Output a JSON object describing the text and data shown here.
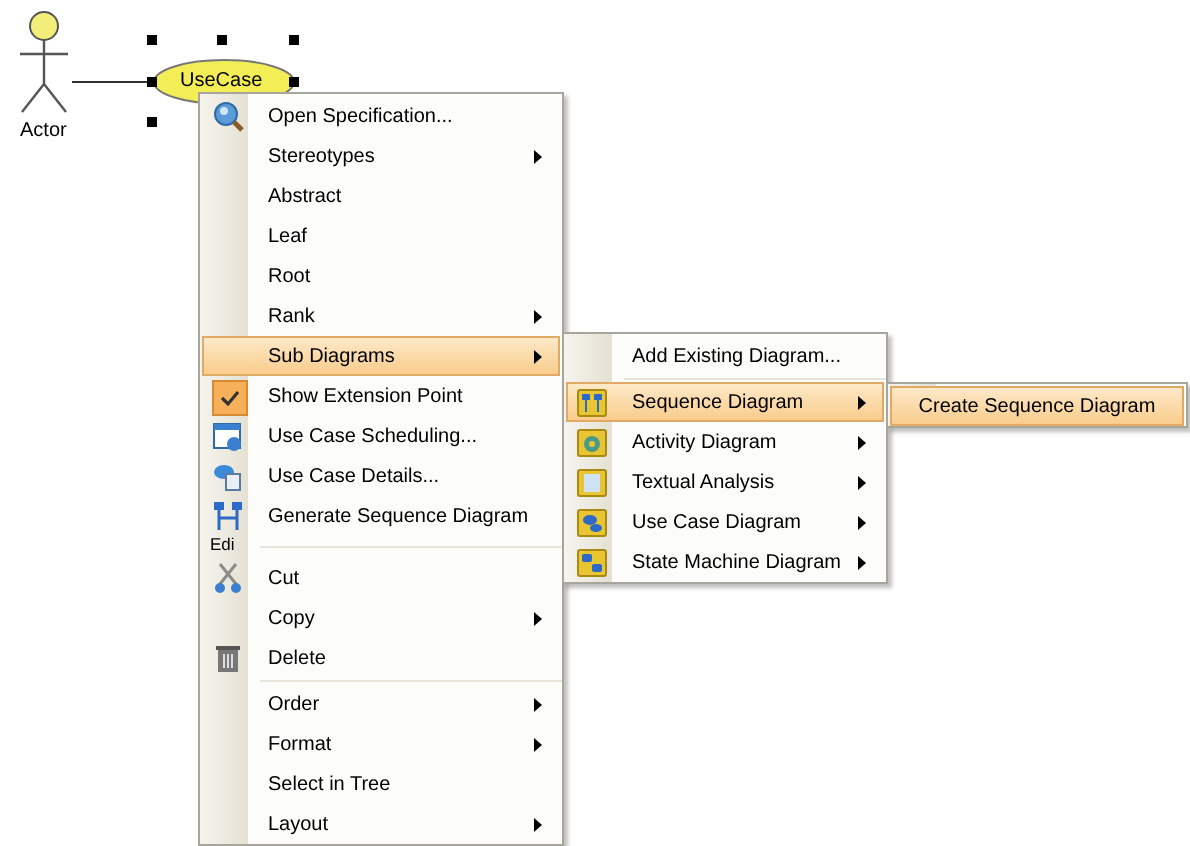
{
  "diagram": {
    "actor": {
      "label": "Actor"
    },
    "use_case": {
      "label": "UseCase",
      "selected": true
    }
  },
  "context_menu": {
    "groups": [
      {
        "items": [
          {
            "kind": "spec",
            "label": "Open Specification...",
            "submenu": false,
            "selected": false
          },
          {
            "kind": "plain",
            "label": "Stereotypes",
            "submenu": true,
            "selected": false
          },
          {
            "kind": "plain",
            "label": "Abstract",
            "submenu": false,
            "selected": false
          },
          {
            "kind": "plain",
            "label": "Leaf",
            "submenu": false,
            "selected": false
          },
          {
            "kind": "plain",
            "label": "Root",
            "submenu": false,
            "selected": false
          },
          {
            "kind": "plain",
            "label": "Rank",
            "submenu": true,
            "selected": false
          },
          {
            "kind": "plain",
            "label": "Sub Diagrams",
            "submenu": true,
            "selected": true
          },
          {
            "kind": "check",
            "label": "Show Extension Point",
            "submenu": false,
            "selected": false,
            "checked": true
          },
          {
            "kind": "schedule",
            "label": "Use Case Scheduling...",
            "submenu": false,
            "selected": false
          },
          {
            "kind": "details",
            "label": "Use Case Details...",
            "submenu": false,
            "selected": false
          },
          {
            "kind": "generate",
            "label": "Generate Sequence Diagram",
            "submenu": false,
            "selected": false
          }
        ]
      },
      {
        "fragment": "Edi",
        "items": [
          {
            "kind": "cut",
            "label": "Cut",
            "submenu": false,
            "selected": false
          },
          {
            "kind": "plain",
            "label": "Copy",
            "submenu": true,
            "selected": false
          },
          {
            "kind": "delete",
            "label": "Delete",
            "submenu": false,
            "selected": false
          }
        ]
      },
      {
        "items": [
          {
            "kind": "plain",
            "label": "Order",
            "submenu": true,
            "selected": false
          },
          {
            "kind": "plain",
            "label": "Format",
            "submenu": true,
            "selected": false
          },
          {
            "kind": "plain",
            "label": "Select in Tree",
            "submenu": false,
            "selected": false
          },
          {
            "kind": "plain",
            "label": "Layout",
            "submenu": true,
            "selected": false
          }
        ]
      }
    ]
  },
  "sub_menu": {
    "groups": [
      {
        "items": [
          {
            "kind": "plain",
            "label": "Add Existing Diagram...",
            "submenu": false,
            "selected": false
          }
        ]
      },
      {
        "items": [
          {
            "kind": "sequence",
            "label": "Sequence Diagram",
            "submenu": true,
            "selected": true
          },
          {
            "kind": "activity",
            "label": "Activity Diagram",
            "submenu": true,
            "selected": false
          },
          {
            "kind": "textual",
            "label": "Textual Analysis",
            "submenu": true,
            "selected": false
          },
          {
            "kind": "usecase",
            "label": "Use Case Diagram",
            "submenu": true,
            "selected": false
          },
          {
            "kind": "statemachine",
            "label": "State Machine Diagram",
            "submenu": true,
            "selected": false
          }
        ]
      }
    ]
  },
  "sub_sub_menu": {
    "groups": [
      {
        "items": [
          {
            "kind": "wide",
            "label": "Create Sequence Diagram",
            "submenu": false,
            "selected": true
          }
        ]
      }
    ]
  }
}
